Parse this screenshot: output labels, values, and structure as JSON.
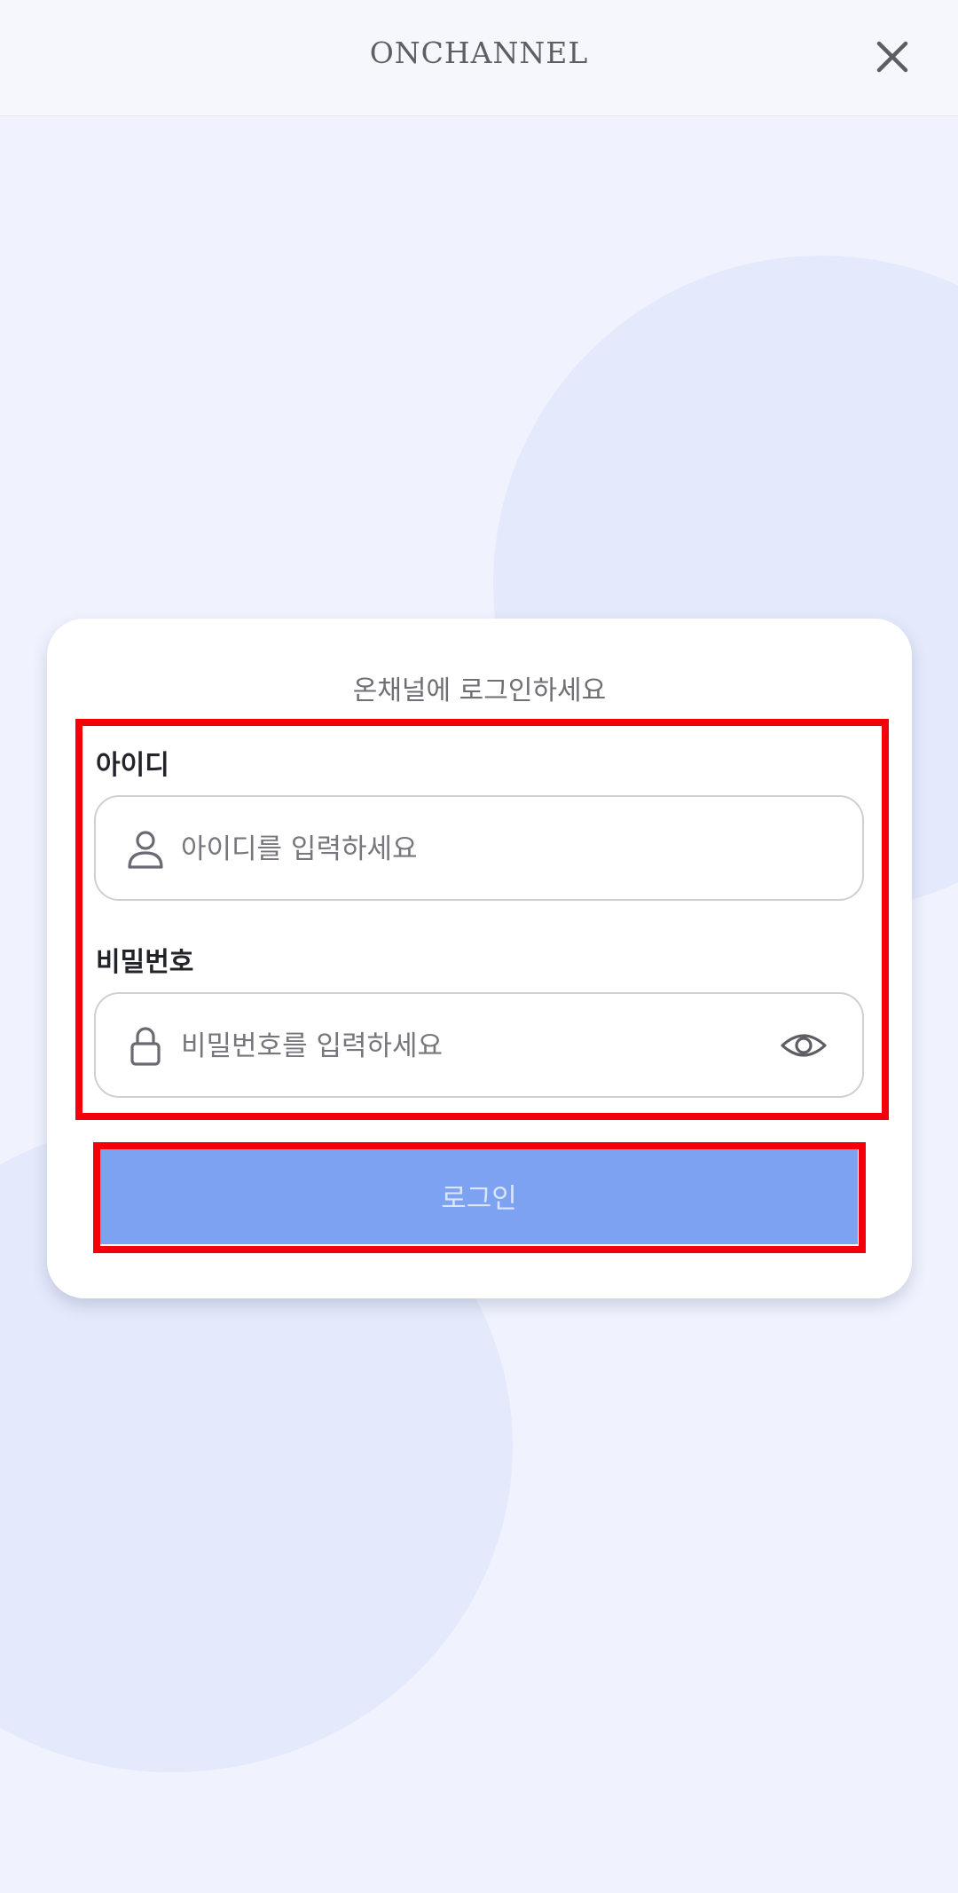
{
  "header": {
    "title": "ONCHANNEL",
    "close_icon": "close-icon"
  },
  "login": {
    "subtitle": "온채널에 로그인하세요",
    "id_label": "아이디",
    "id_placeholder": "아이디를 입력하세요",
    "id_value": "",
    "id_icon": "user-icon",
    "password_label": "비밀번호",
    "password_placeholder": "비밀번호를 입력하세요",
    "password_value": "",
    "password_icon": "lock-icon",
    "toggle_visibility_icon": "eye-icon",
    "submit_label": "로그인"
  },
  "colors": {
    "background": "#f0f3fe",
    "decor_circle": "#e4eafb",
    "button_bg": "#7da2f1",
    "button_text": "#dbe5fb",
    "highlight": "#f3000b"
  }
}
